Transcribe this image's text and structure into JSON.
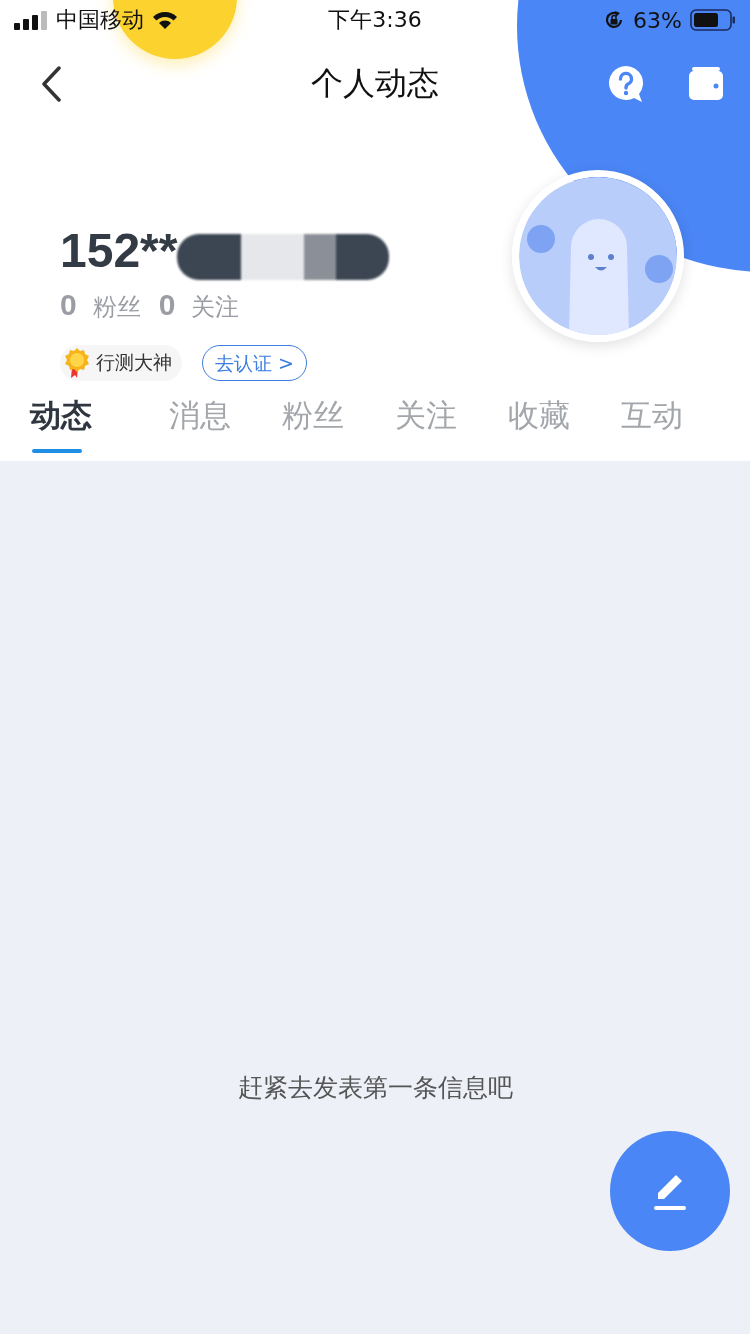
{
  "status_bar": {
    "carrier": "中国移动",
    "time": "下午3:36",
    "battery": "63%"
  },
  "nav": {
    "title": "个人动态"
  },
  "profile": {
    "name": "152**",
    "followers_count": "0",
    "followers_label": "粉丝",
    "following_count": "0",
    "following_label": "关注",
    "badge": "行测大神",
    "verify_link": "去认证 >"
  },
  "tabs": [
    {
      "label": "动态",
      "selected": true
    },
    {
      "label": "消息",
      "selected": false
    },
    {
      "label": "粉丝",
      "selected": false
    },
    {
      "label": "关注",
      "selected": false
    },
    {
      "label": "收藏",
      "selected": false
    },
    {
      "label": "互动",
      "selected": false
    }
  ],
  "empty_message": "赶紧去发表第一条信息吧"
}
